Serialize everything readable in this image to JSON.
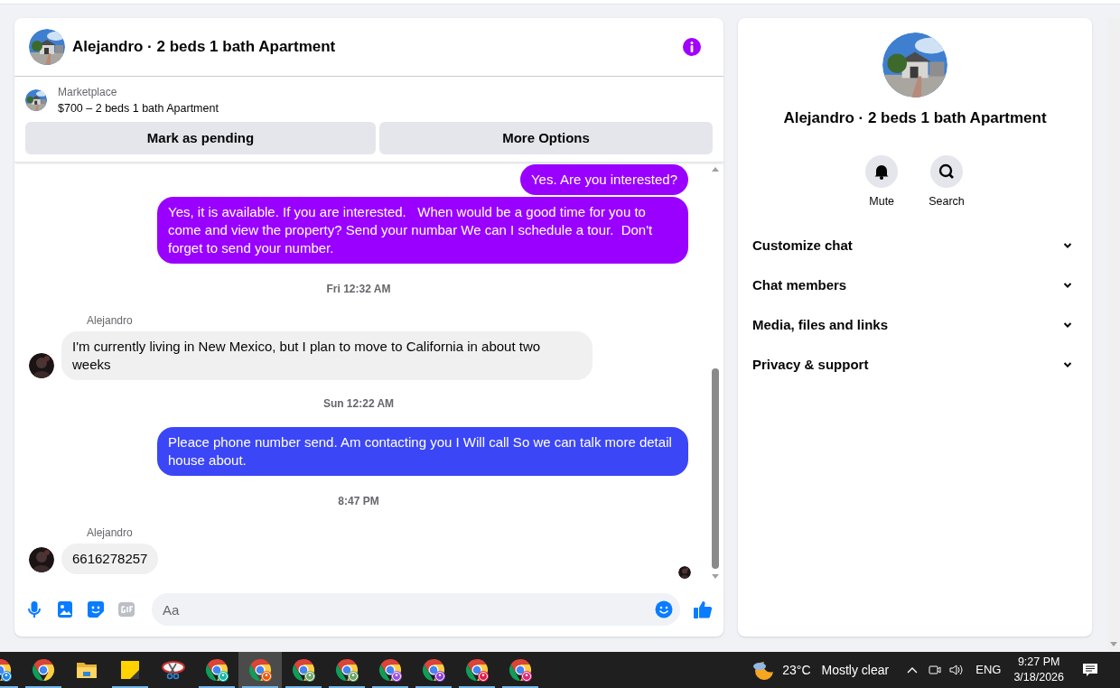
{
  "chat": {
    "title": "Alejandro · 2 beds 1 bath Apartment",
    "listing": {
      "source": "Marketplace",
      "title": "$700 – 2 beds 1 bath Apartment",
      "buttons": [
        "Mark as pending",
        "More Options"
      ]
    },
    "messages": [
      {
        "kind": "outgoing",
        "text": "Yes. Are you interested?",
        "color": "#9900ff"
      },
      {
        "kind": "outgoing",
        "text": "Yes, it is available. If you are interested.   When would be a good time for you to come and view the property? Send your numbar We can I schedule a tour.  Don't forget to send your number.",
        "color": "#9900ff"
      },
      {
        "kind": "timestamp",
        "text": "Fri 12:32 AM"
      },
      {
        "kind": "incoming",
        "sender": "Alejandro",
        "text": "I'm currently living in New Mexico, but I plan to move to California in about two weeks"
      },
      {
        "kind": "timestamp",
        "text": "Sun 12:22 AM"
      },
      {
        "kind": "outgoing",
        "text": "Pleace phone number send. Am contacting you I Will call So we can talk more detail house about.",
        "color": "#3b46f6"
      },
      {
        "kind": "timestamp",
        "text": "8:47 PM"
      },
      {
        "kind": "incoming",
        "sender": "Alejandro",
        "text": "6616278257"
      }
    ],
    "composer": {
      "placeholder": "Aa"
    }
  },
  "details": {
    "title": "Alejandro · 2 beds 1 bath Apartment",
    "actions": [
      {
        "kind": "mute",
        "label": "Mute"
      },
      {
        "kind": "search",
        "label": "Search"
      }
    ],
    "sections": [
      {
        "label": "Customize chat",
        "expanded": false
      },
      {
        "label": "Chat members",
        "expanded": false
      },
      {
        "label": "Media, files and links",
        "expanded": false
      },
      {
        "label": "Privacy & support",
        "expanded": false
      }
    ]
  },
  "taskbar": {
    "apps": [
      {
        "kind": "chrome",
        "color": "#1e88e5",
        "running": true,
        "selected": false
      },
      {
        "kind": "chrome",
        "running": true,
        "selected": false
      },
      {
        "kind": "folder",
        "running": false,
        "selected": false
      },
      {
        "kind": "sticky",
        "running": true,
        "selected": false
      },
      {
        "kind": "snip",
        "running": false,
        "selected": false
      },
      {
        "kind": "chrome",
        "color": "#14b8a6",
        "running": true,
        "selected": false
      },
      {
        "kind": "chrome",
        "color": "#ea580c",
        "running": true,
        "selected": true
      },
      {
        "kind": "chrome",
        "color": "#6ba368",
        "running": true,
        "selected": false
      },
      {
        "kind": "chrome",
        "color": "#6ba368",
        "running": true,
        "selected": false
      },
      {
        "kind": "chrome",
        "color": "#9b51e0",
        "running": true,
        "selected": false
      },
      {
        "kind": "chrome",
        "color": "#8b3fd6",
        "running": true,
        "selected": false
      },
      {
        "kind": "chrome",
        "color": "#e11d48",
        "running": true,
        "selected": false
      },
      {
        "kind": "chrome",
        "color": "#db2777",
        "running": true,
        "selected": false
      }
    ],
    "weather": {
      "temperature": "23°C",
      "condition": "Mostly clear"
    },
    "language": "ENG",
    "time": "9:27 PM",
    "date": "3/18/2026"
  }
}
